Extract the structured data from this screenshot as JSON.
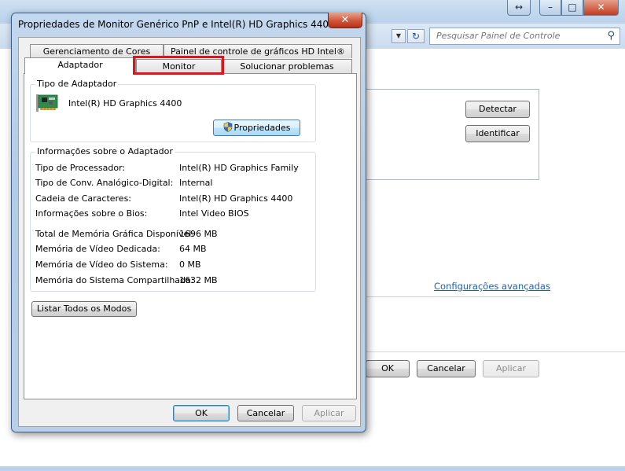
{
  "background_window": {
    "search_placeholder": "Pesquisar Painel de Controle",
    "detect_label": "Detectar",
    "identify_label": "Identificar",
    "advanced_link": "Configurações avançadas",
    "ok_label": "OK",
    "cancel_label": "Cancelar",
    "apply_label": "Aplicar"
  },
  "dialog": {
    "title": "Propriedades de Monitor Genérico PnP e Intel(R) HD Graphics 4400",
    "tabs_row1": [
      "Gerenciamento de Cores",
      "Painel de controle de gráficos HD Intel®"
    ],
    "tabs_row2": [
      "Adaptador",
      "Monitor",
      "Solucionar problemas"
    ],
    "active_tab": "Adaptador",
    "highlighted_tab": "Monitor",
    "highlight_color": "#e3131b",
    "adapter_type": {
      "legend": "Tipo de Adaptador",
      "name": "Intel(R) HD Graphics 4400",
      "properties_button": "Propriedades"
    },
    "adapter_info": {
      "legend": "Informações sobre o Adaptador",
      "rows": [
        {
          "label": "Tipo de Processador:",
          "value": "Intel(R) HD Graphics Family"
        },
        {
          "label": "Tipo de Conv. Analógico-Digital:",
          "value": "Internal"
        },
        {
          "label": "Cadeia de Caracteres:",
          "value": "Intel(R) HD Graphics 4400"
        },
        {
          "label": "Informações sobre o Bios:",
          "value": "Intel Video BIOS"
        }
      ],
      "memory_rows": [
        {
          "label": "Total de Memória Gráfica Disponível:",
          "value": "1696 MB"
        },
        {
          "label": "Memória de Vídeo Dedicada:",
          "value": "64 MB"
        },
        {
          "label": "Memória de Vídeo do Sistema:",
          "value": "0 MB"
        },
        {
          "label": "Memória do Sistema Compartilhada:",
          "value": "1632 MB"
        }
      ]
    },
    "list_modes_button": "Listar Todos os Modos",
    "ok_label": "OK",
    "cancel_label": "Cancelar",
    "apply_label": "Aplicar"
  }
}
